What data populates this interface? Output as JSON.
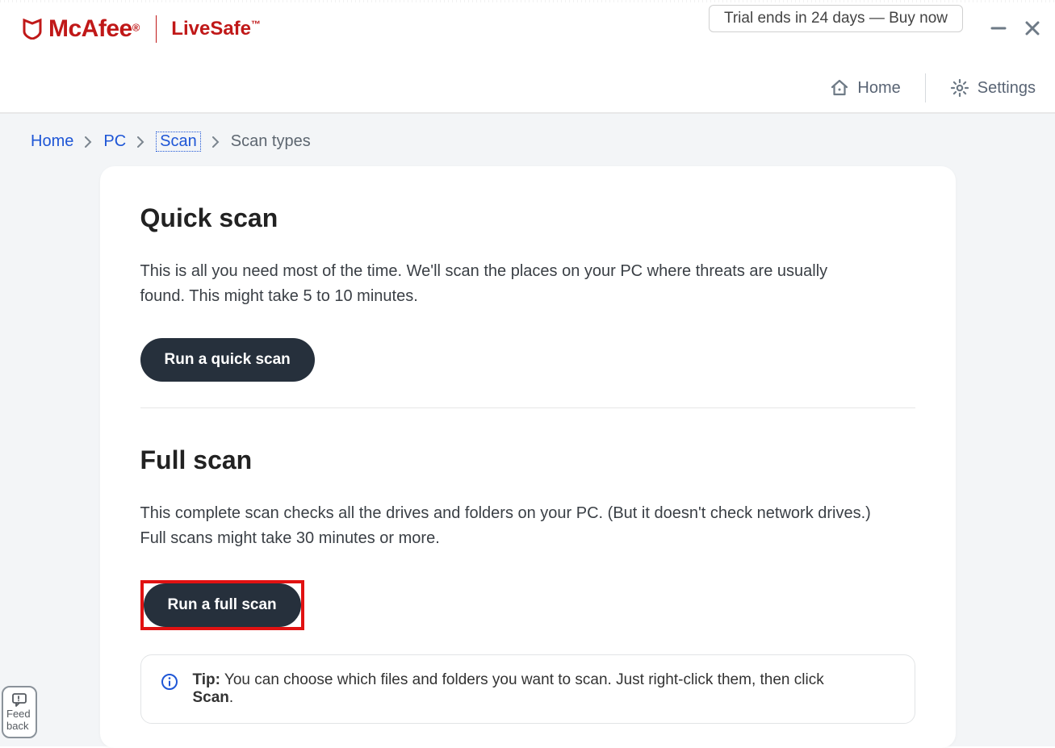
{
  "brand": {
    "name": "McAfee",
    "product": "LiveSafe",
    "reg": "®",
    "tm": "™"
  },
  "header": {
    "trial_text": "Trial ends in 24 days — Buy now",
    "home_label": "Home",
    "settings_label": "Settings"
  },
  "breadcrumb": {
    "home": "Home",
    "pc": "PC",
    "scan": "Scan",
    "current": "Scan types"
  },
  "quick": {
    "title": "Quick scan",
    "desc": "This is all you need most of the time. We'll scan the places on your PC where threats are usually found. This might take 5 to 10 minutes.",
    "button": "Run a quick scan"
  },
  "full": {
    "title": "Full scan",
    "desc": "This complete scan checks all the drives and folders on your PC. (But it doesn't check network drives.) Full scans might take 30 minutes or more.",
    "button": "Run a full scan"
  },
  "tip": {
    "label": "Tip:",
    "text_before": " You can choose which files and folders you want to scan. Just right-click them, then click ",
    "bold_word": "Scan",
    "after": "."
  },
  "feedback": {
    "line1": "Feed",
    "line2": "back"
  }
}
